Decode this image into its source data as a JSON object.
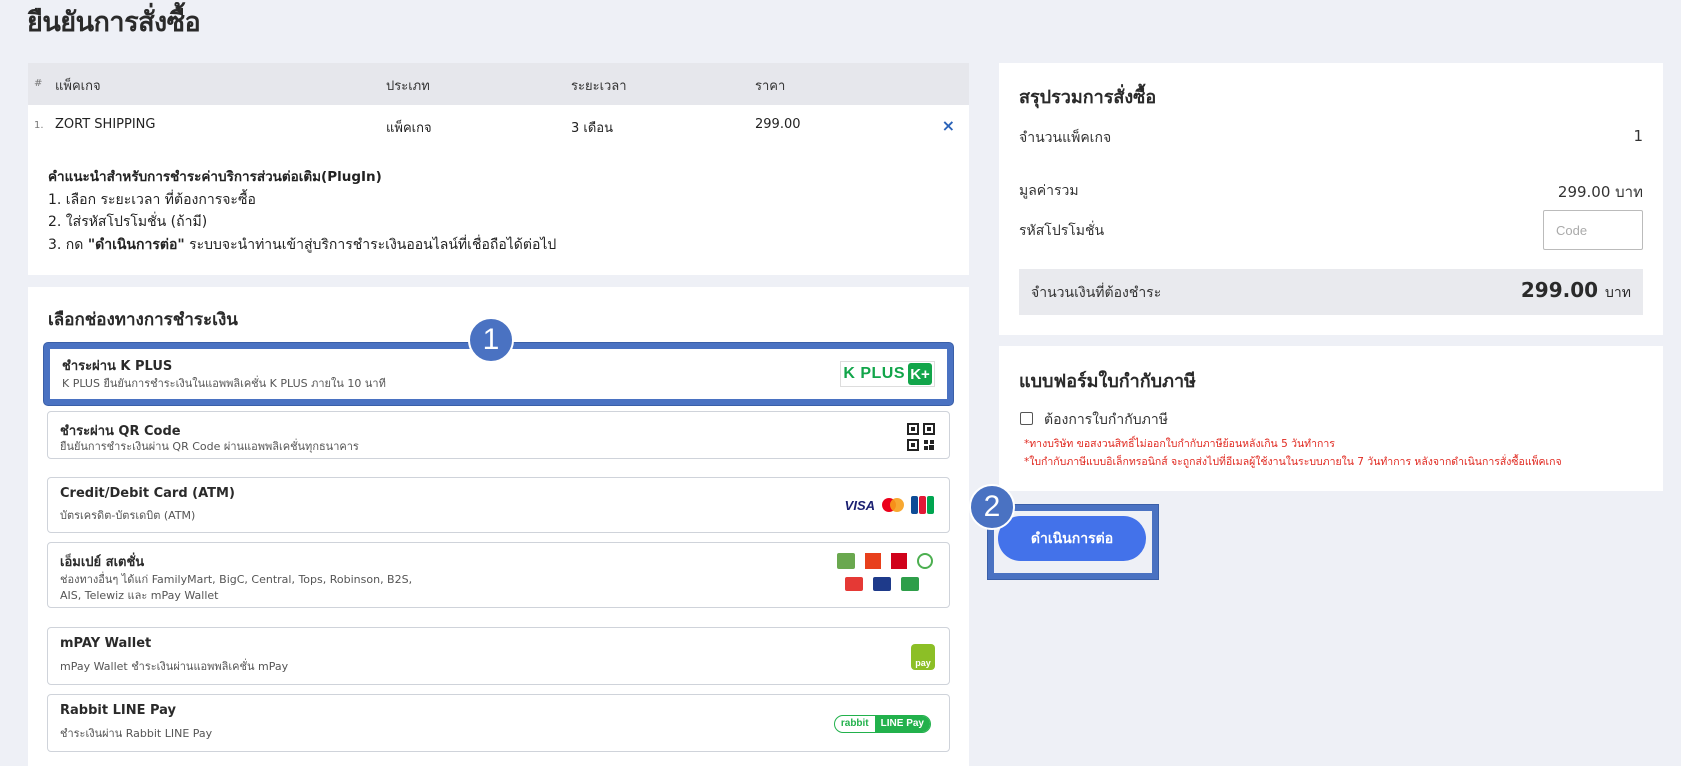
{
  "page": {
    "title": "ยืนยันการสั่งซื้อ"
  },
  "table": {
    "headers": {
      "num": "#",
      "package": "แพ็คเกจ",
      "type": "ประเภท",
      "duration": "ระยะเวลา",
      "price": "ราคา"
    },
    "rows": [
      {
        "num": "1.",
        "package": "ZORT SHIPPING",
        "type": "แพ็คเกจ",
        "duration": "3 เดือน",
        "price": "299.00",
        "remove": "×"
      }
    ]
  },
  "instructions": {
    "title": "คำแนะนำสำหรับการชำระค่าบริการส่วนต่อเติม(PlugIn)",
    "step1": "1. เลือก ระยะเวลา ที่ต้องการจะซื้อ",
    "step2": "2. ใส่รหัสโปรโมชั่น (ถ้ามี)",
    "step3_prefix": "3. กด ",
    "step3_bold": "\"ดำเนินการต่อ\"",
    "step3_suffix": " ระบบจะนำท่านเข้าสู่บริการชำระเงินออนไลน์ที่เชื่อถือได้ต่อไป"
  },
  "payment": {
    "title": "เลือกช่องทางการชำระเงิน",
    "options": [
      {
        "name": "ชำระผ่าน K PLUS",
        "desc": "K PLUS ยืนยันการชำระเงินในแอพพลิเคชั่น K PLUS ภายใน 10 นาที",
        "logo_text": "K PLUS"
      },
      {
        "name": "ชำระผ่าน QR Code",
        "desc": "ยืนยันการชำระเงินผ่าน QR Code ผ่านแอพพลิเคชั่นทุกธนาคาร"
      },
      {
        "name": "Credit/Debit Card (ATM)",
        "desc": "บัตรเครดิต-บัตรเดบิต (ATM)",
        "logo_visa": "VISA"
      },
      {
        "name": "เอ็มเปย์ สเตชั่น",
        "desc": "ช่องทางอื่นๆ ได้แก่ FamilyMart, BigC, Central, Tops, Robinson, B2S, AIS, Telewiz และ mPay Wallet"
      },
      {
        "name": "mPAY Wallet",
        "desc": "mPay Wallet ชำระเงินผ่านแอพพลิเคชั่น mPay",
        "logo_text": "pay"
      },
      {
        "name": "Rabbit LINE Pay",
        "desc": "ชำระเงินผ่าน Rabbit LINE Pay",
        "logo_left": "rabbit",
        "logo_right": "LINE Pay"
      }
    ]
  },
  "summary": {
    "title": "สรุปรวมการสั่งซื้อ",
    "count_label": "จำนวนแพ็คเกจ",
    "count_value": "1",
    "subtotal_label": "มูลค่ารวม",
    "subtotal_value": "299.00 บาท",
    "promo_label": "รหัสโปรโมชั่น",
    "promo_placeholder": "Code",
    "total_label": "จำนวนเงินที่ต้องชำระ",
    "total_value": "299.00",
    "total_unit": "บาท"
  },
  "tax": {
    "title": "แบบฟอร์มใบกำกับภาษี",
    "checkbox_label": "ต้องการใบกำกับภาษี",
    "checked": false,
    "note1": "*ทางบริษัท ขอสงวนสิทธิ์ไม่ออกใบกำกับภาษีย้อนหลังเกิน 5 วันทำการ",
    "note2": "*ใบกำกับภาษีแบบอิเล็กทรอนิกส์ จะถูกส่งไปที่อีเมลผู้ใช้งานในระบบภายใน 7 วันทำการ หลังจากดำเนินการสั่งซื้อแพ็คเกจ"
  },
  "continue_button": "ดำเนินการต่อ",
  "badges": {
    "step1": "1",
    "step2": "2"
  },
  "colors": {
    "accent": "#4372ea",
    "highlight": "#4a72c2",
    "kplus_green": "#12a54a",
    "note_red": "#e0281f",
    "line_green": "#22b14c"
  }
}
